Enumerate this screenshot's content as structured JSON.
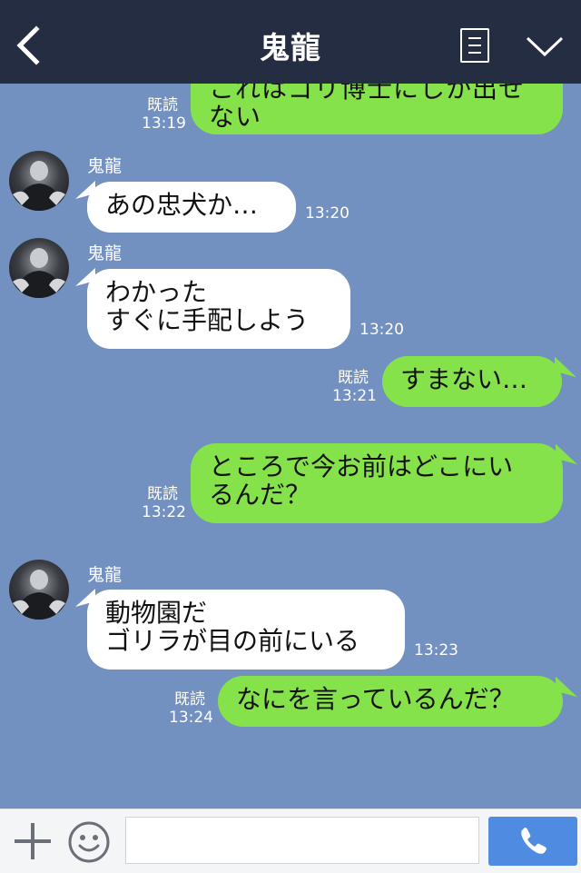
{
  "header": {
    "title": "鬼龍"
  },
  "messages": [
    {
      "dir": "out",
      "text": "これはゴリ博士にしか出せない",
      "read": "既読",
      "time": "13:19"
    },
    {
      "dir": "in",
      "sender": "鬼龍",
      "text": "あの忠犬か…",
      "time": "13:20"
    },
    {
      "dir": "in",
      "sender": "鬼龍",
      "text": "わかった\nすぐに手配しよう",
      "time": "13:20"
    },
    {
      "dir": "out",
      "text": "すまない…",
      "read": "既読",
      "time": "13:21"
    },
    {
      "dir": "out",
      "text": "ところで今お前はどこにい\nるんだ？",
      "read": "既読",
      "time": "13:22"
    },
    {
      "dir": "in",
      "sender": "鬼龍",
      "text": "動物園だ\nゴリラが目の前にいる",
      "time": "13:23"
    },
    {
      "dir": "out",
      "text": "なにを言っているんだ？",
      "read": "既読",
      "time": "13:24"
    }
  ],
  "footer": {
    "input_value": "",
    "input_placeholder": ""
  },
  "icons": {
    "back": "chevron-left-icon",
    "notes": "notes-icon",
    "menu": "chevron-down-icon",
    "plus": "plus-icon",
    "emoji": "smiley-icon",
    "call": "phone-icon"
  },
  "colors": {
    "header_bg": "#252d42",
    "chat_bg": "#7290c0",
    "outgoing_bubble": "#86e24a",
    "incoming_bubble": "#ffffff",
    "call_button": "#4f8be0"
  }
}
